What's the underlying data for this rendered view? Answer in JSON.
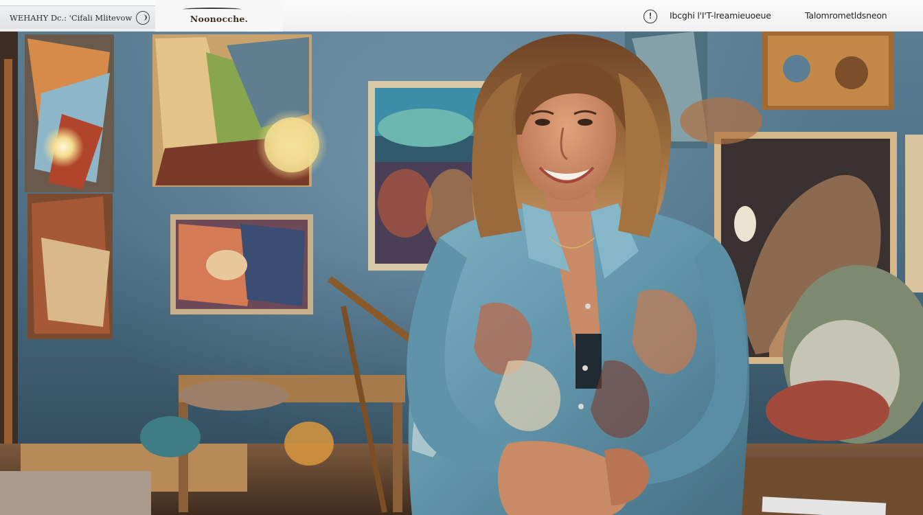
{
  "header": {
    "brand_text": "WEHAHY Dc.: 'Cifali Mlitevow",
    "logo_text": "Noonocche.",
    "info_icon": "info-circle-icon",
    "info_glyph": "!",
    "nav": [
      {
        "label": "Ibcghi l'I'T-lreamieuoeue"
      },
      {
        "label": "Talomrometldsneon"
      }
    ]
  },
  "hero": {
    "image_description_icon": "photo-hero-image",
    "colors": {
      "wall": "#4a6d83",
      "shirt": "#6f9fb3",
      "hair": "#8a5a34",
      "skin": "#c98a66",
      "frame": "#d9c9a8"
    }
  }
}
